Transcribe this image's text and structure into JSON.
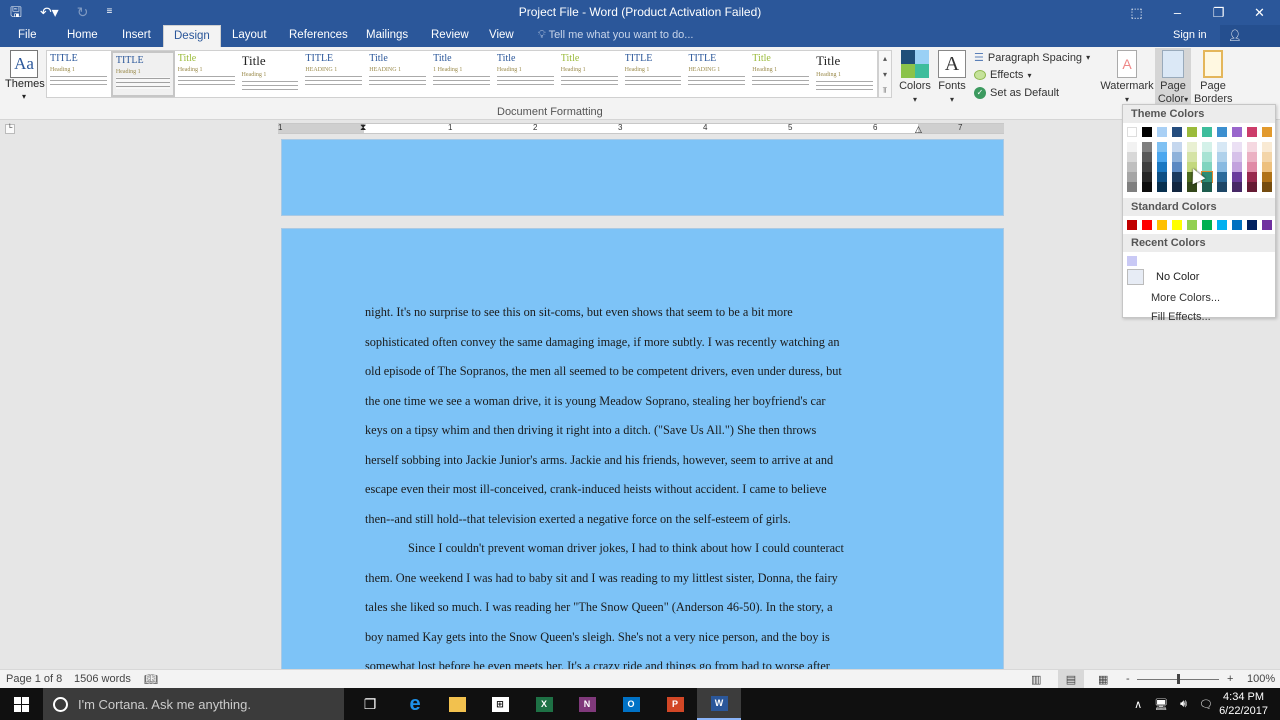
{
  "window": {
    "title": "Project File - Word (Product Activation Failed)",
    "controls": [
      "ribbon-display-options",
      "minimize",
      "restore",
      "close"
    ]
  },
  "qat": {
    "save_icon": "save-icon",
    "undo_icon": "undo-icon",
    "redo_icon": "redo-icon",
    "customize_icon": "customize-icon"
  },
  "tabs": [
    {
      "label": "File"
    },
    {
      "label": "Home"
    },
    {
      "label": "Insert"
    },
    {
      "label": "Design",
      "active": true
    },
    {
      "label": "Layout"
    },
    {
      "label": "References"
    },
    {
      "label": "Mailings"
    },
    {
      "label": "Review"
    },
    {
      "label": "View"
    }
  ],
  "tellme": {
    "placeholder": "Tell me what you want to do..."
  },
  "account": {
    "signin": "Sign in",
    "share": "Share"
  },
  "ribbon": {
    "themes_label": "Themes",
    "themes_glyph": "Aa",
    "style_gallery": [
      {
        "title": "TITLE",
        "heading": "Heading 1"
      },
      {
        "title": "TITLE",
        "heading": "Heading 1"
      },
      {
        "title": "Title",
        "heading": "Heading 1"
      },
      {
        "title": "Title",
        "heading": "Heading 1"
      },
      {
        "title": "TITLE",
        "heading": "HEADING 1"
      },
      {
        "title": "Title",
        "heading": "HEADING 1"
      },
      {
        "title": "Title",
        "heading": "1 Heading 1"
      },
      {
        "title": "Title",
        "heading": "Heading 1"
      },
      {
        "title": "Title",
        "heading": "Heading 1"
      },
      {
        "title": "TITLE",
        "heading": "Heading 1"
      },
      {
        "title": "TITLE",
        "heading": "HEADING 1"
      },
      {
        "title": "Title",
        "heading": "Heading 1"
      },
      {
        "title": "Title",
        "heading": "Heading 1"
      }
    ],
    "document_formatting_label": "Document Formatting",
    "colors_label": "Colors",
    "fonts_label": "Fonts",
    "fonts_glyph": "A",
    "paragraph_spacing_label": "Paragraph Spacing",
    "effects_label": "Effects",
    "set_default_label": "Set as Default",
    "watermark_label": "Watermark",
    "page_color_label_1": "Page",
    "page_color_label_2": "Color",
    "page_borders_label_1": "Page",
    "page_borders_label_2": "Borders"
  },
  "ruler": {
    "numbers": [
      "1",
      "1",
      "2",
      "3",
      "4",
      "5",
      "6",
      "7"
    ]
  },
  "page_color_menu": {
    "theme_header": "Theme Colors",
    "theme_top": [
      "#ffffff",
      "#000000",
      "#a9d0f5",
      "#254d7e",
      "#9bbb3b",
      "#3ebd9c",
      "#3c8fcf",
      "#9966cc",
      "#cc3d6a",
      "#e29a2e"
    ],
    "theme_shades": [
      [
        "#f2f2f2",
        "#d8d8d8",
        "#bfbfbf",
        "#a5a5a5",
        "#7f7f7f"
      ],
      [
        "#7f7f7f",
        "#595959",
        "#3f3f3f",
        "#262626",
        "#0d0d0d"
      ],
      [
        "#7fc1f3",
        "#4ba7ef",
        "#1a78c2",
        "#0e4f84",
        "#08304f"
      ],
      [
        "#c5d7ee",
        "#8fb2da",
        "#5b89c2",
        "#1b3a5e",
        "#12263f"
      ],
      [
        "#e9f0d3",
        "#d5e3a6",
        "#c3d87d",
        "#4c6a1c",
        "#33471a"
      ],
      [
        "#d4f1e9",
        "#a8e3d4",
        "#80d4bf",
        "#2e8d75",
        "#1e5d4e"
      ],
      [
        "#d7e8f5",
        "#afd1eb",
        "#88bae1",
        "#2c6b9a",
        "#1e4767"
      ],
      [
        "#ebe0f4",
        "#d6c1e9",
        "#c2a2dd",
        "#6a3c9c",
        "#472866"
      ],
      [
        "#f5d8e1",
        "#ebb1c3",
        "#e08aa6",
        "#98294e",
        "#661b34"
      ],
      [
        "#f9ead4",
        "#f3d5a9",
        "#edc07e",
        "#b07218",
        "#754c10"
      ]
    ],
    "hovered_swatch": {
      "column": 5,
      "shade": 3
    },
    "standard_header": "Standard Colors",
    "standard": [
      "#c00000",
      "#ff0000",
      "#ffc000",
      "#ffff00",
      "#92d050",
      "#00b050",
      "#00b0f0",
      "#0070c0",
      "#002060",
      "#7030a0"
    ],
    "recent_header": "Recent Colors",
    "recent": [
      "#c9c9f5"
    ],
    "no_color_label": "No Color",
    "more_colors_label": "More Colors...",
    "fill_effects_label": "Fill Effects..."
  },
  "document": {
    "page_color": "#7dc3f7",
    "lines": [
      "night.  It's no surprise to see this on sit-coms, but even shows that seem to be a bit more",
      "sophisticated often convey the same damaging image, if more subtly.  I was recently watching an",
      "old episode of The Sopranos, the men all seemed to be competent drivers, even under duress, but",
      "the one time we see a woman drive, it is young Meadow Soprano, stealing her boyfriend's car",
      "keys on a tipsy whim and then driving it right into a ditch. (\"Save Us All.\") She then throws",
      "herself sobbing into Jackie Junior's arms. Jackie and his friends, however, seem to arrive at and",
      "escape even their most ill-conceived, crank-induced heists without accident.  I came to believe",
      "then--and still hold--that television exerted a negative force on the self-esteem of girls.",
      "Since I couldn't prevent woman driver jokes, I had to think about how I could counteract",
      "them.  One weekend I was had to baby sit and I was reading to my littlest sister, Donna, the fairy",
      "tales she liked so much.  I was reading her \"The Snow Queen\"  (Anderson 46-50). In the story, a",
      "boy named Kay gets into the Snow Queen's sleigh.  She's not a very nice person, and the boy is",
      "somewhat lost before he even meets her.  It's a crazy ride and things go from bad to worse after"
    ]
  },
  "statusbar": {
    "page": "Page 1 of 8",
    "words": "1506 words",
    "zoom_level": "100%",
    "zoom_minus": "-",
    "zoom_plus": "+",
    "zoom_fraction": 0.5
  },
  "taskbar": {
    "cortana_placeholder": "I'm Cortana. Ask me anything.",
    "apps": [
      "task-view",
      "edge",
      "file-explorer",
      "store",
      "excel",
      "onenote",
      "outlook",
      "powerpoint",
      "word"
    ],
    "time": "4:34 PM",
    "date": "6/22/2017"
  }
}
